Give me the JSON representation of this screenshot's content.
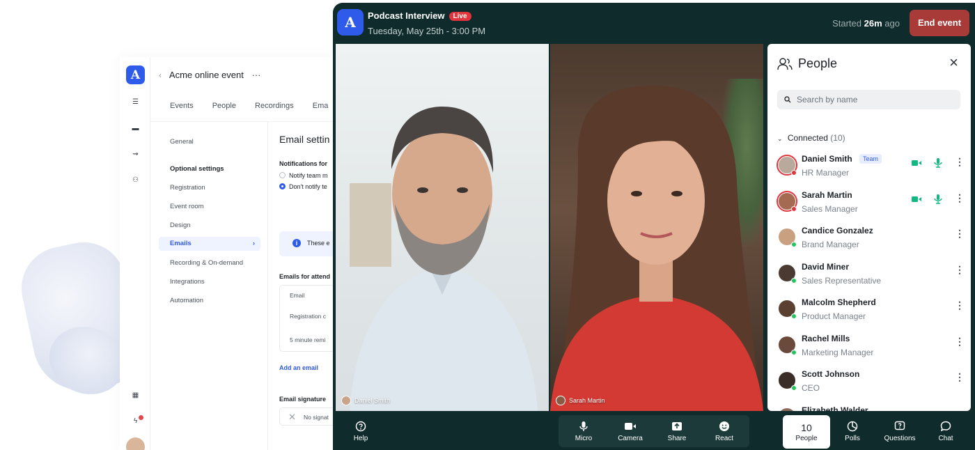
{
  "back_app": {
    "logo": "A",
    "event_title": "Acme online event",
    "more": "···",
    "tabs": [
      "Events",
      "People",
      "Recordings",
      "Ema"
    ],
    "nav": {
      "general": "General",
      "optional_header": "Optional settings",
      "registration": "Registration",
      "event_room": "Event room",
      "design": "Design",
      "emails": "Emails",
      "recording": "Recording & On-demand",
      "integrations": "Integrations",
      "automation": "Automation"
    },
    "main": {
      "title": "Email settin",
      "notifications_label": "Notifications for",
      "option_1": "Notify team m",
      "option_2": "Don't notify te",
      "info_text": "These e",
      "emails_for_attendees": "Emails for attend",
      "table_header": "Email",
      "row_1": "Registration c",
      "row_2": "5 minute remi",
      "add_email": "Add an email",
      "signature_label": "Email signature",
      "signature_value": "No signat"
    }
  },
  "call": {
    "logo": "A",
    "title": "Podcast Interview",
    "live_badge": "Live",
    "date": "Tuesday, May 25th - 3:00 PM",
    "started_prefix": "Started",
    "started_duration": "26m",
    "started_suffix": "ago",
    "end_button": "End event",
    "tiles": [
      {
        "name": "Daniel Smith"
      },
      {
        "name": "Sarah Martin"
      }
    ]
  },
  "people_panel": {
    "title": "People",
    "search_placeholder": "Search by name",
    "group_label": "Connected",
    "group_count": "(10)",
    "team_badge": "Team",
    "people": [
      {
        "name": "Daniel Smith",
        "role": "HR Manager"
      },
      {
        "name": "Sarah Martin",
        "role": "Sales Manager"
      },
      {
        "name": "Candice Gonzalez",
        "role": "Brand Manager"
      },
      {
        "name": "David Miner",
        "role": "Sales Representative"
      },
      {
        "name": "Malcolm Shepherd",
        "role": "Product Manager"
      },
      {
        "name": "Rachel Mills",
        "role": "Marketing Manager"
      },
      {
        "name": "Scott Johnson",
        "role": "CEO"
      },
      {
        "name": "Elizabeth Walder",
        "role": ""
      }
    ]
  },
  "toolbar": {
    "help": "Help",
    "micro": "Micro",
    "camera": "Camera",
    "share": "Share",
    "react": "React",
    "people_count": "10",
    "people": "People",
    "polls": "Polls",
    "questions": "Questions",
    "chat": "Chat"
  },
  "colors": {
    "brand": "#2f5bea",
    "call_bg": "#0f2b2b",
    "live": "#e0353c",
    "end_event": "#a83a38",
    "online": "#22c55e",
    "media_on": "#10b981"
  }
}
